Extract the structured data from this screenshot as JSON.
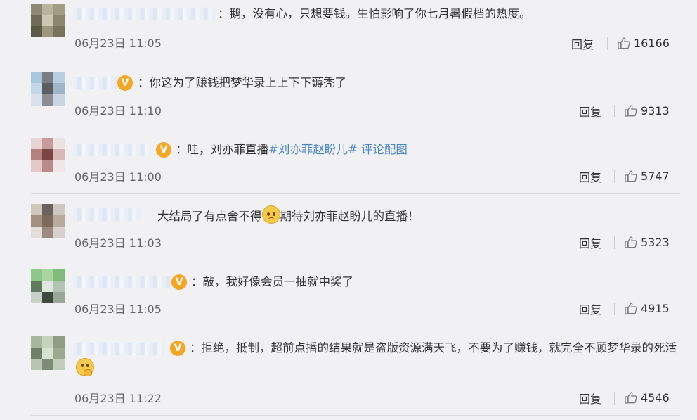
{
  "comments": [
    {
      "text": "鹅，没有心，只想要钱。生怕影响了你七月暑假档的热度。",
      "time": "06月23日 11:05",
      "reply": "回复",
      "likes": "16166"
    },
    {
      "text": "你这为了赚钱把梦华录上上下下薅秃了",
      "time": "06月23日 11:10",
      "reply": "回复",
      "likes": "9313"
    },
    {
      "text_prefix": "哇，刘亦菲直播",
      "topic": "#刘亦菲赵盼儿#",
      "link": " 评论配图",
      "time": "06月23日 11:00",
      "reply": "回复",
      "likes": "5747"
    },
    {
      "text_a": "大结局了有点舍不得",
      "text_b": "期待刘亦菲赵盼儿的直播！",
      "time": "06月23日 11:03",
      "reply": "回复",
      "likes": "5323"
    },
    {
      "text": "敲，我好像会员一抽就中奖了",
      "time": "06月23日 11:05",
      "reply": "回复",
      "likes": "4915"
    },
    {
      "text": "拒绝，抵制，超前点播的结果就是盗版资源满天飞，不要为了赚钱，就完全不顾梦华录的死活",
      "time": "06月23日 11:22",
      "reply": "回复",
      "likes": "4546"
    }
  ],
  "colon": "：",
  "vip_mark": "V",
  "colors": {
    "topic": "#4a86c5",
    "vip": "#f5a623",
    "background": "#f1f1f4"
  }
}
